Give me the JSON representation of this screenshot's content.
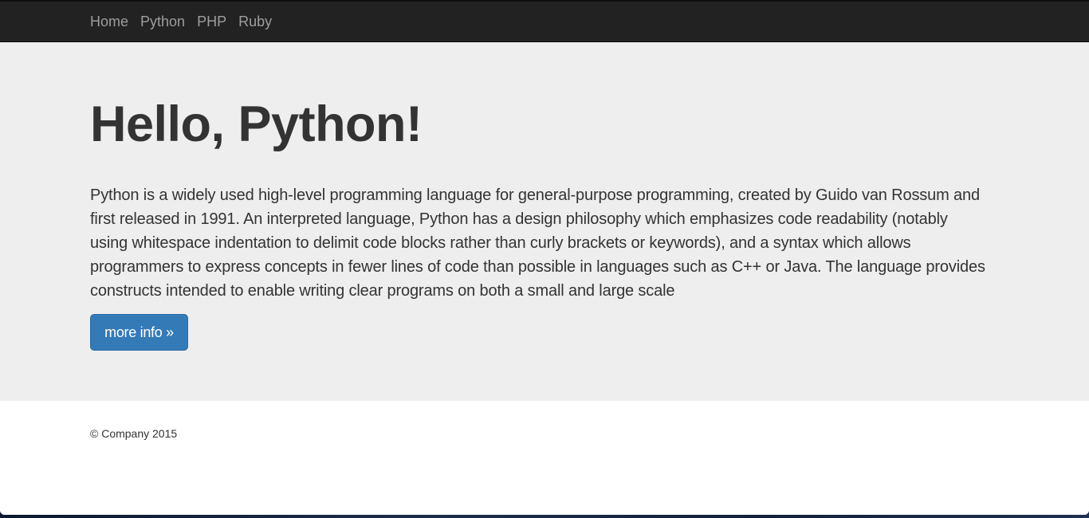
{
  "navbar": {
    "links": [
      "Home",
      "Python",
      "PHP",
      "Ruby"
    ]
  },
  "jumbotron": {
    "title": "Hello, Python!",
    "description": "Python is a widely used high-level programming language for general-purpose programming, created by Guido van Rossum and first released in 1991. An interpreted language, Python has a design philosophy which emphasizes code readability (notably using whitespace indentation to delimit code blocks rather than curly brackets or keywords), and a syntax which allows programmers to express concepts in fewer lines of code than possible in languages such as C++ or Java. The language provides constructs intended to enable writing clear programs on both a small and large scale",
    "button_label": "more info »"
  },
  "footer": {
    "text": "© Company 2015"
  },
  "colors": {
    "navbar_bg": "#222222",
    "nav_link": "#9d9d9d",
    "jumbotron_bg": "#eeeeee",
    "primary_button": "#337ab7",
    "text": "#333333"
  }
}
